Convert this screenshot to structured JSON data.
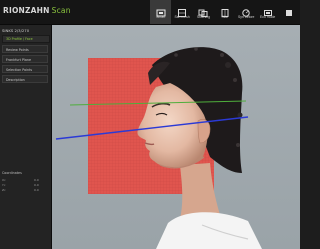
{
  "app": {
    "logo_text": "RIONZAHN",
    "logo_accent": "Scan"
  },
  "toolbar": {
    "items": [
      {
        "label": "Smart",
        "icon": "smart-icon"
      },
      {
        "label": "Ssh mesh",
        "icon": "mesh-icon"
      },
      {
        "label": "Stitching",
        "icon": "stitching-icon"
      },
      {
        "label": "Side",
        "icon": "side-icon"
      },
      {
        "label": "Syn before",
        "icon": "sync-icon"
      },
      {
        "label": "Eco mode",
        "icon": "eco-icon"
      },
      {
        "label": "",
        "icon": "window-icon"
      }
    ]
  },
  "panel": {
    "title": "SINKS 2/3/270",
    "subtitle": "3D Profile / Face",
    "buttons": [
      "Review Points",
      "Frankfurt Plane",
      "Selection Points",
      "Description"
    ],
    "bottom_title": "Coordinates",
    "bottom_rows": [
      {
        "label": "Xc",
        "value": "0.0"
      },
      {
        "label": "Yc",
        "value": "0.0"
      },
      {
        "label": "Zc",
        "value": "0.0"
      }
    ]
  },
  "colors": {
    "accent": "#8cc63f",
    "plane": "#e0554e",
    "line_green": "#4fae3c",
    "line_blue": "#2b3ad6"
  }
}
